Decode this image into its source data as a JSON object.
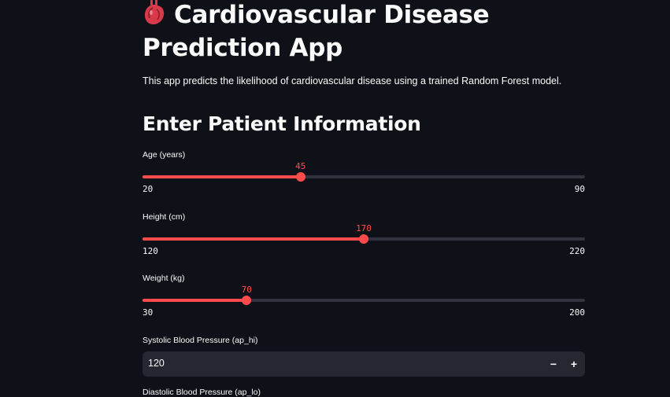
{
  "header": {
    "title_icon": "anatomical-heart-icon",
    "title_line1": "Cardiovascular Disease",
    "title_line2": "Prediction App",
    "subtitle": "This app predicts the likelihood of cardiovascular disease using a trained Random Forest model."
  },
  "form": {
    "section_title": "Enter Patient Information",
    "sliders": [
      {
        "label": "Age (years)",
        "min": 20,
        "max": 90,
        "value": 45
      },
      {
        "label": "Height (cm)",
        "min": 120,
        "max": 220,
        "value": 170
      },
      {
        "label": "Weight (kg)",
        "min": 30,
        "max": 200,
        "value": 70
      }
    ],
    "systolic": {
      "label": "Systolic Blood Pressure (ap_hi)",
      "value": "120",
      "decrement": "−",
      "increment": "+"
    },
    "diastolic": {
      "label": "Diastolic Blood Pressure (ap_lo)"
    }
  },
  "colors": {
    "accent": "#ff4b4b",
    "background": "#0e1117",
    "input_bg": "#262730",
    "track": "#31333f"
  }
}
